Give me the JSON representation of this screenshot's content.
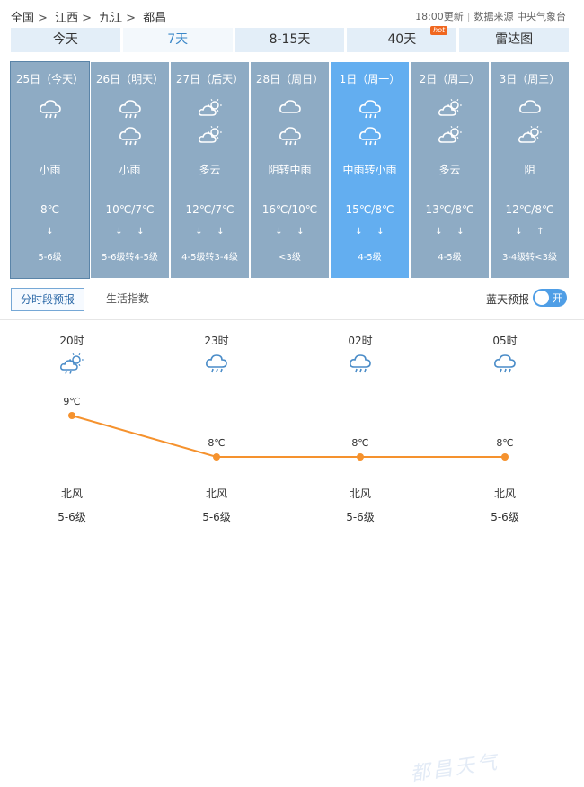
{
  "breadcrumb": [
    "全国",
    "江西",
    "九江",
    "都昌"
  ],
  "breadcrumb_sep": ">",
  "update_time": "18:00更新",
  "data_source": "数据来源 中央气象台",
  "tabs": [
    {
      "label": "今天",
      "hot": ""
    },
    {
      "label": "7天",
      "hot": ""
    },
    {
      "label": "8-15天",
      "hot": ""
    },
    {
      "label": "40天",
      "hot": "hot"
    },
    {
      "label": "雷达图",
      "hot": ""
    }
  ],
  "active_tab": "7天",
  "days": [
    {
      "date": "25日（今天）",
      "icon_day": "rain-cloud-icon",
      "icon_night": "",
      "desc": "小雨",
      "temp": "8℃",
      "wind_arrows": [
        "↓"
      ],
      "level": "5-6级"
    },
    {
      "date": "26日（明天）",
      "icon_day": "rain-cloud-icon",
      "icon_night": "rain-cloud-icon",
      "desc": "小雨",
      "temp": "10℃/7℃",
      "wind_arrows": [
        "↓",
        "↓"
      ],
      "level": "5-6级转4-5级"
    },
    {
      "date": "27日（后天）",
      "icon_day": "partly-cloudy-icon",
      "icon_night": "partly-cloudy-icon",
      "desc": "多云",
      "temp": "12℃/7℃",
      "wind_arrows": [
        "↓",
        "↓"
      ],
      "level": "4-5级转3-4级"
    },
    {
      "date": "28日（周日）",
      "icon_day": "cloud-icon",
      "icon_night": "rain-cloud-icon",
      "desc": "阴转中雨",
      "temp": "16℃/10℃",
      "wind_arrows": [
        "↓",
        "↓"
      ],
      "level": "<3级"
    },
    {
      "date": "1日（周一）",
      "icon_day": "rain-cloud-icon",
      "icon_night": "rain-cloud-icon",
      "desc": "中雨转小雨",
      "temp": "15℃/8℃",
      "wind_arrows": [
        "↓",
        "↓"
      ],
      "level": "4-5级"
    },
    {
      "date": "2日（周二）",
      "icon_day": "partly-cloudy-icon",
      "icon_night": "partly-cloudy-icon",
      "desc": "多云",
      "temp": "13℃/8℃",
      "wind_arrows": [
        "↓",
        "↓"
      ],
      "level": "4-5级"
    },
    {
      "date": "3日（周三）",
      "icon_day": "cloud-icon",
      "icon_night": "partly-cloudy-icon",
      "desc": "阴",
      "temp": "12℃/8℃",
      "wind_arrows": [
        "↓",
        "↑"
      ],
      "level": "3-4级转<3级"
    }
  ],
  "subtabs": {
    "hourly": "分时段预报",
    "life": "生活指数"
  },
  "blue_sky": {
    "label": "蓝天预报",
    "toggle": "开"
  },
  "hourly": [
    {
      "time": "20时",
      "icon": "partly-cloudy-rain-icon",
      "temp": "9℃",
      "temp_value": 9,
      "wind_dir": "北风",
      "wind_level": "5-6级"
    },
    {
      "time": "23时",
      "icon": "rain-cloud-icon",
      "temp": "8℃",
      "temp_value": 8,
      "wind_dir": "北风",
      "wind_level": "5-6级"
    },
    {
      "time": "02时",
      "icon": "rain-cloud-icon",
      "temp": "8℃",
      "temp_value": 8,
      "wind_dir": "北风",
      "wind_level": "5-6级"
    },
    {
      "time": "05时",
      "icon": "rain-cloud-icon",
      "temp": "8℃",
      "temp_value": 8,
      "wind_dir": "北风",
      "wind_level": "5-6级"
    }
  ],
  "colors": {
    "line": "#f5922e",
    "selected_day": "#63aef0",
    "day_bg": "#8eabc4"
  }
}
